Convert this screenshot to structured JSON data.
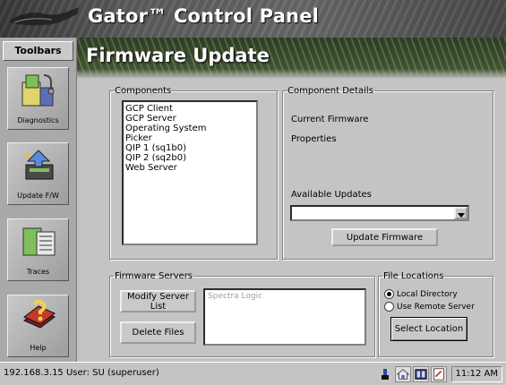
{
  "header": {
    "app_title": "Gator™ Control Panel"
  },
  "toolbar": {
    "title": "Toolbars",
    "items": [
      {
        "label": "Diagnostics",
        "icon": "diagnostics-icon"
      },
      {
        "label": "Update F/W",
        "icon": "update-firmware-icon"
      },
      {
        "label": "Traces",
        "icon": "traces-icon"
      },
      {
        "label": "Help",
        "icon": "help-icon"
      }
    ]
  },
  "page": {
    "title": "Firmware Update"
  },
  "components": {
    "legend": "Components",
    "items": [
      "GCP Client",
      "GCP Server",
      "Operating System",
      "Picker",
      "QIP 1 (sq1b0)",
      "QIP 2 (sq2b0)",
      "Web Server"
    ]
  },
  "component_details": {
    "legend": "Component Details",
    "current_firmware_label": "Current Firmware",
    "properties_label": "Properties",
    "available_updates_label": "Available Updates",
    "available_updates_value": "",
    "update_button": "Update Firmware"
  },
  "firmware_servers": {
    "legend": "Firmware Servers",
    "modify_button": "Modify Server List",
    "delete_button": "Delete Files",
    "servers_text": "Spectra Logic"
  },
  "file_locations": {
    "legend": "File Locations",
    "options": [
      "Local Directory",
      "Use Remote Server"
    ],
    "selected": "Local Directory",
    "select_button": "Select Location"
  },
  "status_bar": {
    "text": "192.168.3.15 User: SU (superuser)",
    "time": "11:12 AM"
  },
  "colors": {
    "background": "#c4c4c4",
    "toolbar": "#a9a9a9",
    "banner": "#4a4a4a",
    "title_text": "#ffffff"
  }
}
